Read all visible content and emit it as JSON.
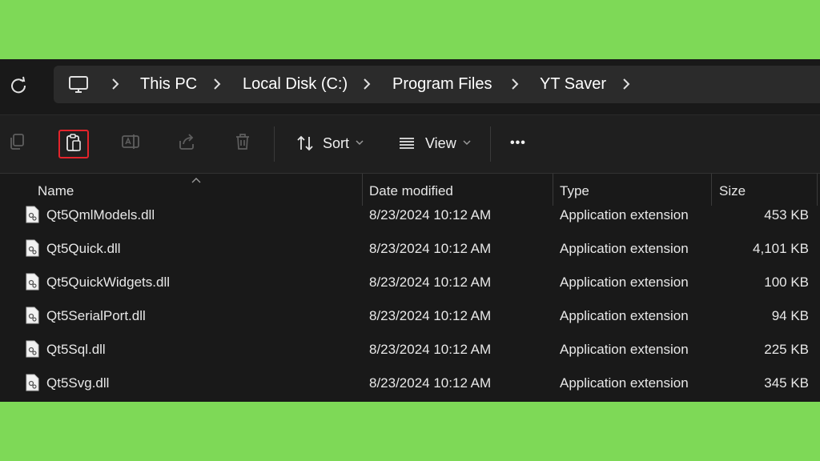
{
  "breadcrumb": [
    "This PC",
    "Local Disk (C:)",
    "Program Files",
    "YT Saver"
  ],
  "toolbar": {
    "sort_label": "Sort",
    "view_label": "View",
    "more_label": "•••"
  },
  "columns": {
    "name": "Name",
    "date": "Date modified",
    "type": "Type",
    "size": "Size"
  },
  "files": [
    {
      "name": "Qt5QmlModels.dll",
      "date": "8/23/2024 10:12 AM",
      "type": "Application extension",
      "size": "453 KB"
    },
    {
      "name": "Qt5Quick.dll",
      "date": "8/23/2024 10:12 AM",
      "type": "Application extension",
      "size": "4,101 KB"
    },
    {
      "name": "Qt5QuickWidgets.dll",
      "date": "8/23/2024 10:12 AM",
      "type": "Application extension",
      "size": "100 KB"
    },
    {
      "name": "Qt5SerialPort.dll",
      "date": "8/23/2024 10:12 AM",
      "type": "Application extension",
      "size": "94 KB"
    },
    {
      "name": "Qt5Sql.dll",
      "date": "8/23/2024 10:12 AM",
      "type": "Application extension",
      "size": "225 KB"
    },
    {
      "name": "Qt5Svg.dll",
      "date": "8/23/2024 10:12 AM",
      "type": "Application extension",
      "size": "345 KB"
    }
  ],
  "colors": {
    "background": "#7ed957",
    "window": "#191919",
    "highlight": "#e3242b"
  }
}
